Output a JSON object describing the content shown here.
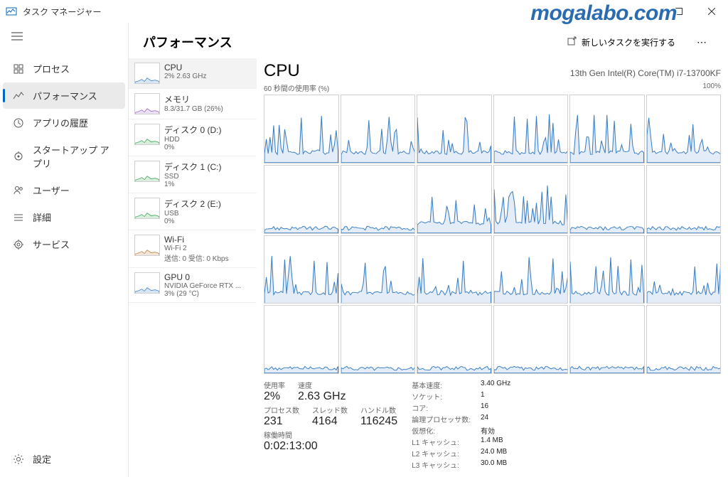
{
  "app_title": "タスク マネージャー",
  "watermark": "mogalabo.com",
  "sidebar": {
    "items": [
      {
        "icon": "processes",
        "label": "プロセス"
      },
      {
        "icon": "performance",
        "label": "パフォーマンス"
      },
      {
        "icon": "history",
        "label": "アプリの履歴"
      },
      {
        "icon": "startup",
        "label": "スタートアップ アプリ"
      },
      {
        "icon": "users",
        "label": "ユーザー"
      },
      {
        "icon": "details",
        "label": "詳細"
      },
      {
        "icon": "services",
        "label": "サービス"
      }
    ],
    "settings": "設定"
  },
  "content_title": "パフォーマンス",
  "run_task_label": "新しいタスクを実行する",
  "perf_list": [
    {
      "name": "CPU",
      "sub": "2%  2.63 GHz",
      "color": "#3a7ec5"
    },
    {
      "name": "メモリ",
      "sub": "8.3/31.7 GB (26%)",
      "color": "#9b5fc5"
    },
    {
      "name": "ディスク 0 (D:)",
      "sub": "HDD",
      "sub2": "0%",
      "color": "#3aa555"
    },
    {
      "name": "ディスク 1 (C:)",
      "sub": "SSD",
      "sub2": "1%",
      "color": "#3aa555"
    },
    {
      "name": "ディスク 2 (E:)",
      "sub": "USB",
      "sub2": "0%",
      "color": "#3aa555"
    },
    {
      "name": "Wi-Fi",
      "sub": "Wi-Fi 2",
      "sub2": "送信: 0  受信: 0 Kbps",
      "color": "#c57a3a"
    },
    {
      "name": "GPU 0",
      "sub": "NVIDIA GeForce RTX ...",
      "sub2": "3%  (29 °C)",
      "color": "#3a7ec5"
    }
  ],
  "detail": {
    "title": "CPU",
    "model": "13th Gen Intel(R) Core(TM) i7-13700KF",
    "chart_label_left": "60 秒間の使用率 (%)",
    "chart_label_right": "100%",
    "stats_left": {
      "usage_label": "使用率",
      "usage": "2%",
      "speed_label": "速度",
      "speed": "2.63 GHz",
      "proc_label": "プロセス数",
      "proc": "231",
      "thread_label": "スレッド数",
      "thread": "4164",
      "handle_label": "ハンドル数",
      "handle": "116245",
      "uptime_label": "稼働時間",
      "uptime": "0:02:13:00"
    },
    "stats_right": [
      {
        "k": "基本速度:",
        "v": "3.40 GHz"
      },
      {
        "k": "ソケット:",
        "v": "1"
      },
      {
        "k": "コア:",
        "v": "16"
      },
      {
        "k": "論理プロセッサ数:",
        "v": "24"
      },
      {
        "k": "仮想化:",
        "v": "有効"
      },
      {
        "k": "L1 キャッシュ:",
        "v": "1.4 MB"
      },
      {
        "k": "L2 キャッシュ:",
        "v": "24.0 MB"
      },
      {
        "k": "L3 キャッシュ:",
        "v": "30.0 MB"
      }
    ]
  },
  "chart_data": {
    "type": "area",
    "title": "CPU per-core usage, 60 seconds, 24 logical processors",
    "ylabel": "Usage %",
    "ylim": [
      0,
      100
    ],
    "series_count": 24,
    "series_description": "24 mini area charts, one per logical processor. Most cores idle near 0-5%. Cores 0-5 and 12-17 show intermittent spikes up to ~40-70%. Remaining cores mostly flat near baseline."
  }
}
